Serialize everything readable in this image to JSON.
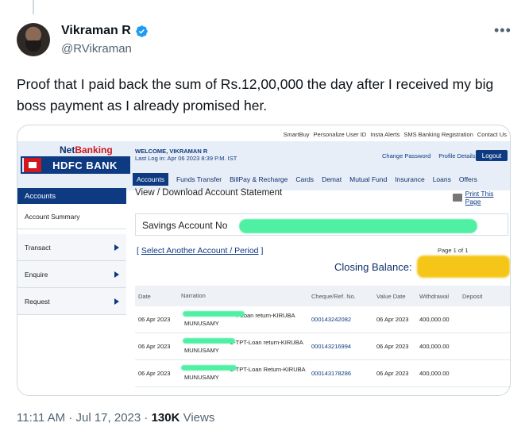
{
  "tweet": {
    "author_name": "Vikraman R",
    "author_handle": "@RVikraman",
    "text": "Proof that I paid back the sum of Rs.12,00,000 the day after I received my big boss payment as I already promised her.",
    "time": "11:11 AM",
    "date": "Jul 17, 2023",
    "separator": "·",
    "views_count": "130K",
    "views_label": "Views",
    "more_icon": "more-icon",
    "verified_icon": "verified-icon"
  },
  "bank": {
    "top_links": [
      "SmartBuy",
      "Personalize User ID",
      "Insta Alerts",
      "SMS Banking Registration",
      "Contact Us"
    ],
    "netbanking_label_1": "Net",
    "netbanking_label_2": "Banking",
    "bank_name": "HDFC BANK",
    "welcome": "WELCOME, VIKRAMAN R",
    "last_login": "Last Log in: Apr 06 2023 8:39 P.M. IST",
    "header_links": [
      "Change Password",
      "Profile Details"
    ],
    "logout": "Logout",
    "menu": [
      "Accounts",
      "Funds Transfer",
      "BillPay & Recharge",
      "Cards",
      "Demat",
      "Mutual Fund",
      "Insurance",
      "Loans",
      "Offers"
    ],
    "sidebar": {
      "header": "Accounts",
      "items": [
        "Account Summary",
        "Transact",
        "Enquire",
        "Request"
      ]
    },
    "page_heading": "View / Download Account Statement",
    "print_label": "Print This Page",
    "account_label": "Savings Account No",
    "select_link": "Select Another Account / Period",
    "page_of": "Page 1 of 1",
    "closing_label": "Closing Balance:",
    "columns": [
      "Date",
      "Narration",
      "Cheque/Ref. No.",
      "Value Date",
      "Withdrawal",
      "Deposit"
    ],
    "rows": [
      {
        "date": "06 Apr 2023",
        "narr_1": "T-Loan return-KIRUBA",
        "narr_2": "MUNUSAMY",
        "ref": "000143242082",
        "value_date": "06 Apr 2023",
        "withdrawal": "400,000.00",
        "deposit": ""
      },
      {
        "date": "06 Apr 2023",
        "narr_1": "2-TPT-Loan return-KIRUBA",
        "narr_2": "MUNUSAMY",
        "ref": "000143216994",
        "value_date": "06 Apr 2023",
        "withdrawal": "400,000.00",
        "deposit": ""
      },
      {
        "date": "06 Apr 2023",
        "narr_1": "2-TPT-Loan Return-KIRUBA",
        "narr_2": "MUNUSAMY",
        "ref": "000143178286",
        "value_date": "06 Apr 2023",
        "withdrawal": "400,000.00",
        "deposit": ""
      }
    ],
    "colors": {
      "brand_blue": "#0e3a82",
      "brand_red": "#d0161e",
      "redaction_green": "#4ff0a4",
      "redaction_yellow": "#f5c517"
    }
  }
}
